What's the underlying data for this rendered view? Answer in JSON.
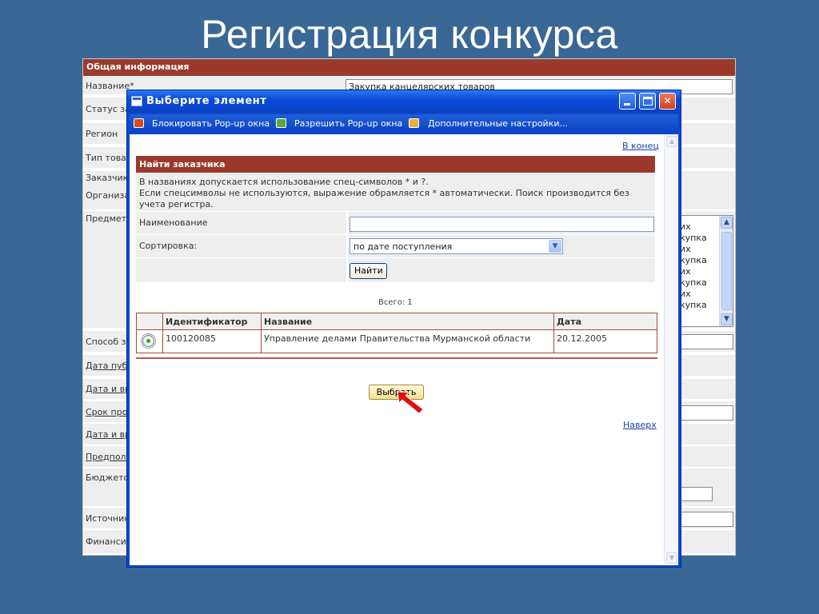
{
  "slide": {
    "title": "Регистрация конкурса"
  },
  "background_form": {
    "header": "Общая информация",
    "rows": [
      {
        "label": "Название*",
        "value": "Закупка канцелярских товаров"
      },
      {
        "label": "Статус за"
      },
      {
        "label": "Регион"
      },
      {
        "label": "Тип товар"
      },
      {
        "label": "Заказчик"
      },
      {
        "label": "Организа"
      },
      {
        "label": "Предмет"
      },
      {
        "label": "Способ за"
      },
      {
        "label": "Дата публ"
      },
      {
        "label": "Дата и вр"
      },
      {
        "label": "Срок пров"
      },
      {
        "label": "Дата и вр"
      },
      {
        "label": "Предпола"
      },
      {
        "label": "Бюджето"
      },
      {
        "label": "Источник"
      },
      {
        "label": "Финансир"
      }
    ],
    "subject_textarea_lines": [
      "их",
      "купка",
      "их",
      "купка",
      "их",
      "купка",
      "их",
      "купка"
    ]
  },
  "popup": {
    "title": "Выберите элемент",
    "infobar": {
      "block": "Блокировать Pop-up окна",
      "allow": "Разрешить Pop-up окна",
      "settings": "Дополнительные настройки..."
    },
    "link_end": "В конец",
    "link_top": "Наверх",
    "search": {
      "header": "Найти заказчика",
      "note_line1": "В названиях допускается использование спец-символов * и ?.",
      "note_line2": "Если спецсимволы не используются, выражение обрамляется * автоматически. Поиск производится без учета регистра.",
      "name_label": "Наименование",
      "name_value": "",
      "sort_label": "Сортировка:",
      "sort_value": "по дате поступления",
      "find_button": "Найти"
    },
    "results": {
      "total": "Всего: 1",
      "columns": [
        "Идентификатор",
        "Название",
        "Дата"
      ],
      "rows": [
        {
          "id": "100120085",
          "name": "Управление делами Правительства Мурманской области",
          "date": "20.12.2005",
          "selected": true
        }
      ]
    },
    "select_button": "Выбрать"
  },
  "colors": {
    "slide_bg": "#3a6896",
    "header_brown": "#9b3a2c",
    "xp_blue": "#0a47d0",
    "link": "#1a3fb0"
  }
}
